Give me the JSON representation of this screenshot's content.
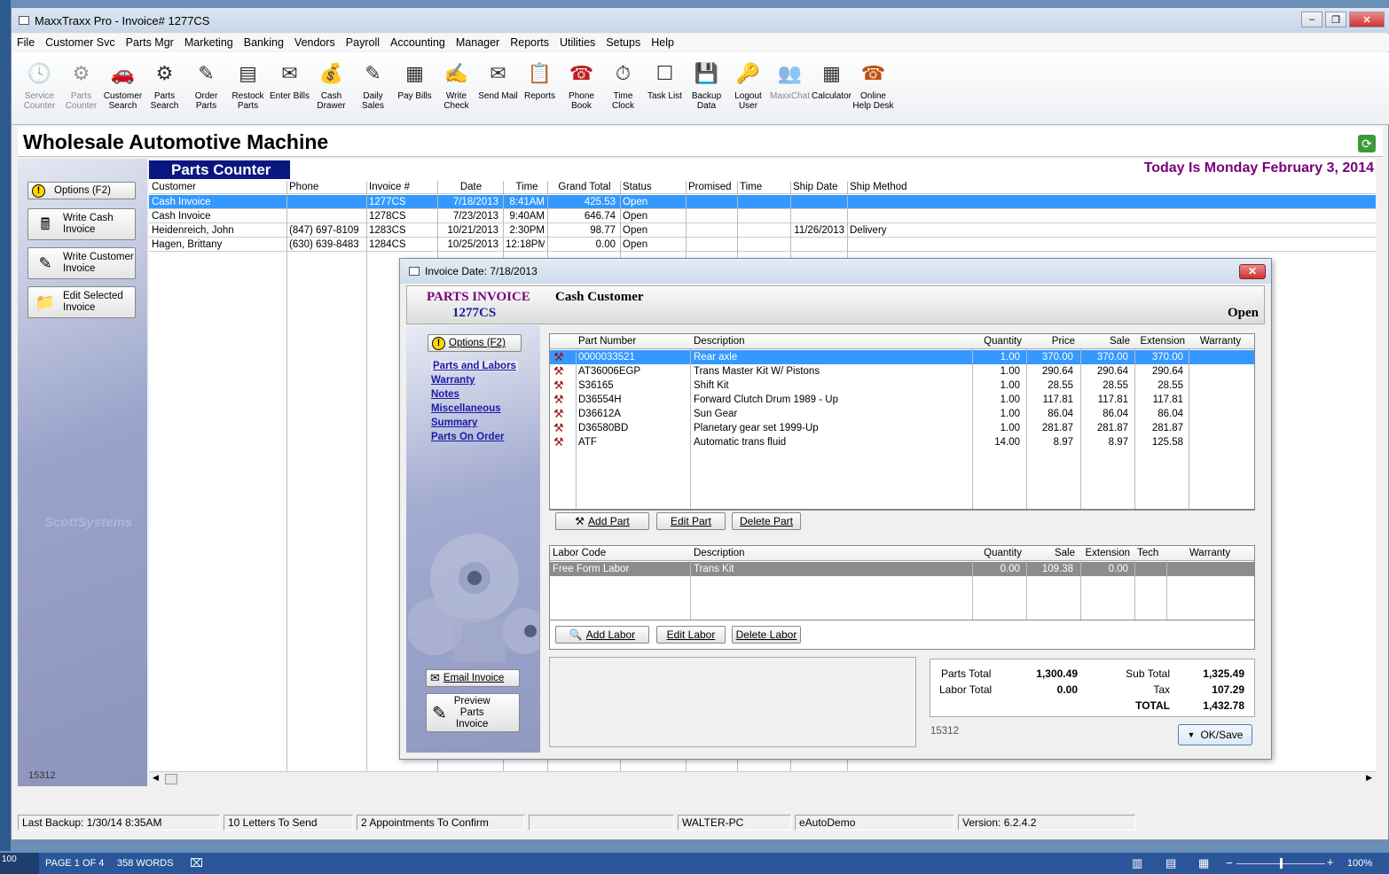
{
  "window": {
    "title": "MaxxTraxx Pro - Invoice# 1277CS"
  },
  "menu": [
    "File",
    "Customer Svc",
    "Parts Mgr",
    "Marketing",
    "Banking",
    "Vendors",
    "Payroll",
    "Accounting",
    "Manager",
    "Reports",
    "Utilities",
    "Setups",
    "Help"
  ],
  "toolbar": [
    {
      "label": "Service\nCounter",
      "icon": "clock-icon",
      "disabled": true
    },
    {
      "label": "Parts\nCounter",
      "icon": "gear-icon",
      "disabled": true
    },
    {
      "label": "Customer\nSearch",
      "icon": "car-icon",
      "disabled": false
    },
    {
      "label": "Parts\nSearch",
      "icon": "part-search-icon",
      "disabled": false
    },
    {
      "label": "Order\nParts",
      "icon": "order-icon",
      "disabled": false
    },
    {
      "label": "Restock\nParts",
      "icon": "restock-icon",
      "disabled": false
    },
    {
      "label": "Enter Bills",
      "icon": "bills-icon",
      "disabled": false
    },
    {
      "label": "Cash\nDrawer",
      "icon": "money-bag-icon",
      "disabled": false
    },
    {
      "label": "Daily\nSales",
      "icon": "daily-sales-icon",
      "disabled": false
    },
    {
      "label": "Pay Bills",
      "icon": "pay-bills-icon",
      "disabled": false
    },
    {
      "label": "Write\nCheck",
      "icon": "check-icon",
      "disabled": false
    },
    {
      "label": "Send Mail",
      "icon": "mail-icon",
      "disabled": false
    },
    {
      "label": "Reports",
      "icon": "clipboard-icon",
      "disabled": false
    },
    {
      "label": "Phone\nBook",
      "icon": "phone-icon",
      "disabled": false
    },
    {
      "label": "Time\nClock",
      "icon": "stopwatch-icon",
      "disabled": false
    },
    {
      "label": "Task List",
      "icon": "task-list-icon",
      "disabled": false
    },
    {
      "label": "Backup\nData",
      "icon": "floppy-icon",
      "disabled": false
    },
    {
      "label": "Logout\nUser",
      "icon": "logout-icon",
      "disabled": false
    },
    {
      "label": "MaxxChat",
      "icon": "chat-icon",
      "disabled": true
    },
    {
      "label": "Calculator",
      "icon": "calculator-icon",
      "disabled": false
    },
    {
      "label": "Online\nHelp Desk",
      "icon": "help-desk-icon",
      "disabled": false
    }
  ],
  "header": {
    "company": "Wholesale Automotive Machine"
  },
  "left_buttons": [
    {
      "label": "Options (F2)",
      "icon": "warning-icon"
    },
    {
      "label": "Write Cash\nInvoice",
      "icon": "cash-register-icon"
    },
    {
      "label": "Write Customer\nInvoice",
      "icon": "invoice-icon"
    },
    {
      "label": "Edit Selected\nInvoice",
      "icon": "folder-icon"
    }
  ],
  "left_panel": {
    "watermark": "ScottSystems",
    "station_id": "15312"
  },
  "parts_counter": {
    "title": "Parts Counter",
    "today": "Today Is Monday  February 3, 2014",
    "columns": [
      "Customer",
      "Phone",
      "Invoice #",
      "Date",
      "Time",
      "Grand Total",
      "Status",
      "Promised",
      "Time",
      "Ship Date",
      "Ship Method"
    ],
    "rows": [
      [
        "Cash Invoice",
        "",
        "1277CS",
        "7/18/2013",
        "8:41AM",
        "425.53",
        "Open",
        "",
        "",
        "",
        ""
      ],
      [
        "Cash Invoice",
        "",
        "1278CS",
        "7/23/2013",
        "9:40AM",
        "646.74",
        "Open",
        "",
        "",
        "",
        ""
      ],
      [
        "Heidenreich, John",
        "(847) 697-8109",
        "1283CS",
        "10/21/2013",
        "2:30PM",
        "98.77",
        "Open",
        "",
        "",
        "11/26/2013",
        "Delivery"
      ],
      [
        "Hagen, Brittany",
        "(630) 639-8483",
        "1284CS",
        "10/25/2013",
        "12:18PM",
        "0.00",
        "Open",
        "",
        "",
        "",
        ""
      ]
    ]
  },
  "status_bar": [
    "Last Backup: 1/30/14  8:35AM",
    "10 Letters To Send",
    "2 Appointments To Confirm",
    "",
    "WALTER-PC",
    "eAutoDemo",
    "Version:  6.2.4.2"
  ],
  "word_bar": {
    "page": "PAGE 1 OF 4",
    "words": "358 WORDS",
    "zoom": "100%",
    "zoom_level": 0.5
  },
  "dialog": {
    "title": "Invoice Date:  7/18/2013",
    "invoice_label": "PARTS INVOICE",
    "invoice_number": "1277CS",
    "customer": "Cash Customer",
    "status": "Open",
    "options_label": "Options (F2)",
    "nav": [
      "Parts and Labors",
      "Warranty",
      "Notes",
      "Miscellaneous",
      "Summary",
      "Parts On Order"
    ],
    "email_label": "Email Invoice",
    "preview_label": "Preview\nParts\nInvoice",
    "parts_columns": [
      "Part Number",
      "Description",
      "Quantity",
      "Price",
      "Sale",
      "Extension",
      "Warranty"
    ],
    "parts": [
      [
        "0000033521",
        "Rear axle",
        "1.00",
        "370.00",
        "370.00",
        "370.00",
        ""
      ],
      [
        "AT36006EGP",
        "Trans Master Kit W/ Pistons",
        "1.00",
        "290.64",
        "290.64",
        "290.64",
        ""
      ],
      [
        "S36165",
        "Shift Kit",
        "1.00",
        "28.55",
        "28.55",
        "28.55",
        ""
      ],
      [
        "D36554H",
        "Forward Clutch Drum 1989 - Up",
        "1.00",
        "117.81",
        "117.81",
        "117.81",
        ""
      ],
      [
        "D36612A",
        "Sun Gear",
        "1.00",
        "86.04",
        "86.04",
        "86.04",
        ""
      ],
      [
        "D36580BD",
        "Planetary gear set 1999-Up",
        "1.00",
        "281.87",
        "281.87",
        "281.87",
        ""
      ],
      [
        "ATF",
        "Automatic trans fluid",
        "14.00",
        "8.97",
        "8.97",
        "125.58",
        ""
      ]
    ],
    "part_buttons": [
      "Add Part",
      "Edit Part",
      "Delete Part"
    ],
    "labor_columns": [
      "Labor Code",
      "Description",
      "Quantity",
      "Sale",
      "Extension",
      "Tech",
      "Warranty"
    ],
    "labor": [
      [
        "Free Form Labor",
        "Trans Kit",
        "0.00",
        "109.38",
        "0.00",
        "",
        ""
      ]
    ],
    "labor_buttons": [
      "Add Labor",
      "Edit Labor",
      "Delete Labor"
    ],
    "totals": {
      "parts_total_label": "Parts Total",
      "parts_total": "1,300.49",
      "labor_total_label": "Labor Total",
      "labor_total": "0.00",
      "sub_total_label": "Sub Total",
      "sub_total": "1,325.49",
      "tax_label": "Tax",
      "tax": "107.29",
      "total_label": "TOTAL",
      "total": "1,432.78"
    },
    "station_id": "15312",
    "ok_label": "OK/Save"
  }
}
